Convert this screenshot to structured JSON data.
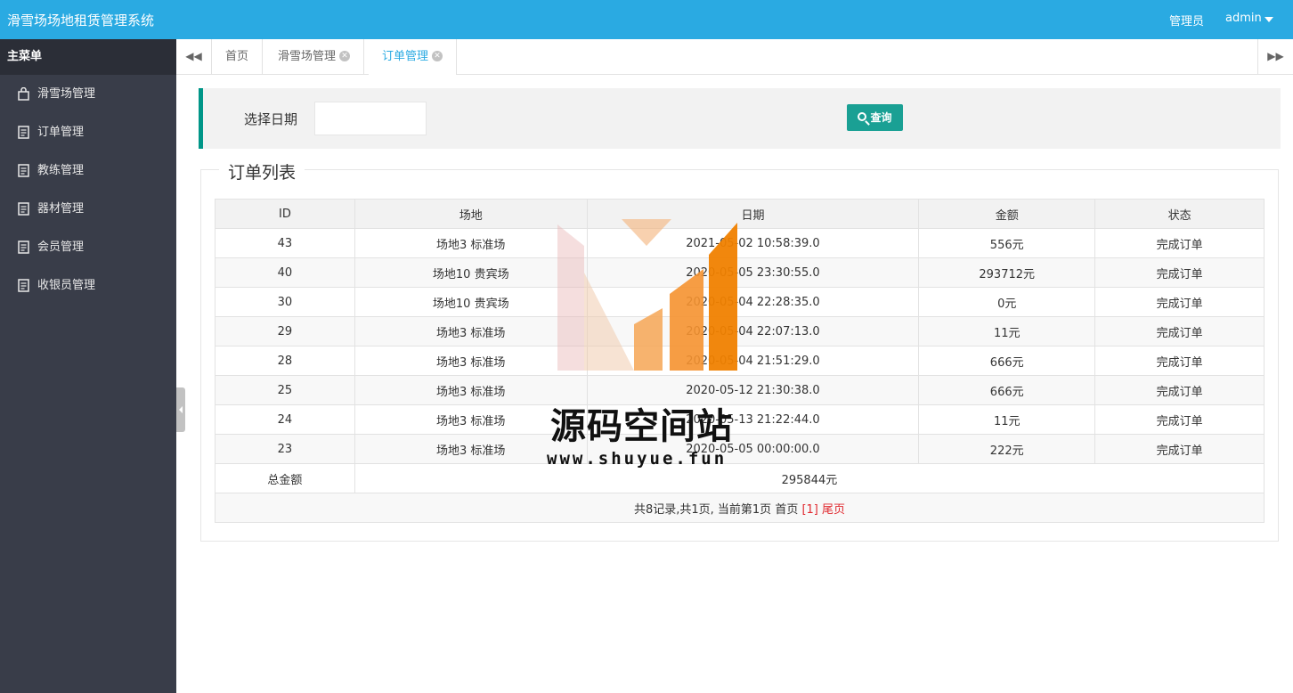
{
  "header": {
    "title": "滑雪场场地租赁管理系统",
    "role": "管理员",
    "user": "admin"
  },
  "sidebar": {
    "title": "主菜单",
    "items": [
      {
        "label": "滑雪场管理",
        "icon": "bag-icon"
      },
      {
        "label": "订单管理",
        "icon": "document-icon"
      },
      {
        "label": "教练管理",
        "icon": "document-icon"
      },
      {
        "label": "器材管理",
        "icon": "document-icon"
      },
      {
        "label": "会员管理",
        "icon": "document-icon"
      },
      {
        "label": "收银员管理",
        "icon": "document-icon"
      }
    ]
  },
  "tabs": [
    {
      "label": "首页",
      "closable": false
    },
    {
      "label": "滑雪场管理",
      "closable": true
    },
    {
      "label": "订单管理",
      "closable": true,
      "active": true
    }
  ],
  "search": {
    "date_label": "选择日期",
    "date_value": "",
    "query_label": "查询"
  },
  "list": {
    "legend": "订单列表",
    "columns": [
      "ID",
      "场地",
      "日期",
      "金额",
      "状态"
    ],
    "rows": [
      [
        "43",
        "场地3 标准场",
        "2021-05-02 10:58:39.0",
        "556元",
        "完成订单"
      ],
      [
        "40",
        "场地10 贵宾场",
        "2020-05-05 23:30:55.0",
        "293712元",
        "完成订单"
      ],
      [
        "30",
        "场地10 贵宾场",
        "2020-05-04 22:28:35.0",
        "0元",
        "完成订单"
      ],
      [
        "29",
        "场地3 标准场",
        "2020-05-04 22:07:13.0",
        "11元",
        "完成订单"
      ],
      [
        "28",
        "场地3 标准场",
        "2020-05-04 21:51:29.0",
        "666元",
        "完成订单"
      ],
      [
        "25",
        "场地3 标准场",
        "2020-05-12 21:30:38.0",
        "666元",
        "完成订单"
      ],
      [
        "24",
        "场地3 标准场",
        "2020-05-13 21:22:44.0",
        "11元",
        "完成订单"
      ],
      [
        "23",
        "场地3 标准场",
        "2020-05-05 00:00:00.0",
        "222元",
        "完成订单"
      ]
    ],
    "total_label": "总金额",
    "total_value": "295844元",
    "pager": {
      "summary": "共8记录,共1页, 当前第1页",
      "first": "首页",
      "current": "[1]",
      "last": "尾页"
    }
  },
  "watermark": {
    "title": "源码空间站",
    "url": "www.shuyue.fun"
  },
  "colors": {
    "header_bg": "#2aaae2",
    "sidebar_bg": "#393d49",
    "accent_green": "#009688",
    "query_button": "#1aa094",
    "pager_red": "#e0292f"
  }
}
